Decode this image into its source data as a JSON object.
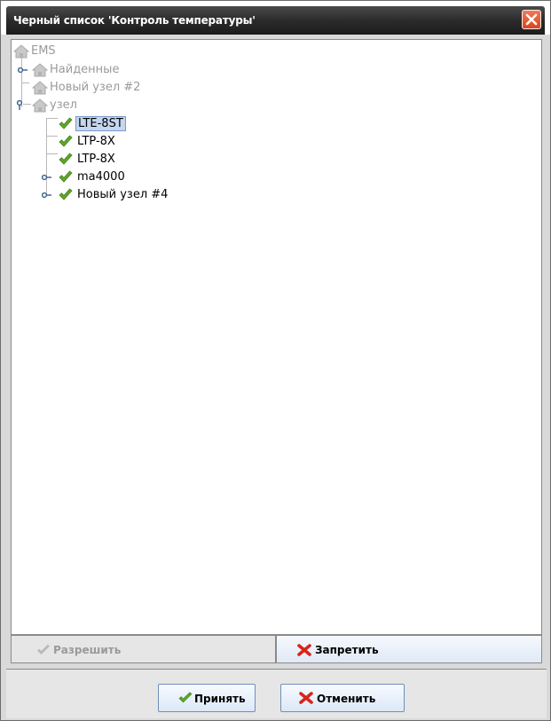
{
  "window": {
    "title": "Черный список 'Контроль температуры'"
  },
  "tree": {
    "nodes": [
      {
        "label": "EMS",
        "enabled": false
      },
      {
        "label": "Найденные",
        "enabled": false
      },
      {
        "label": "Новый узел #2",
        "enabled": false
      },
      {
        "label": "узел",
        "enabled": false
      },
      {
        "label": "LTE-8ST",
        "enabled": true,
        "selected": true
      },
      {
        "label": "LTP-8X",
        "enabled": true
      },
      {
        "label": "LTP-8X",
        "enabled": true
      },
      {
        "label": "ma4000",
        "enabled": true
      },
      {
        "label": "Новый узел #4",
        "enabled": true
      }
    ]
  },
  "actions": {
    "allow_label": "Разрешить",
    "deny_label": "Запретить"
  },
  "dialog": {
    "accept_label": "Принять",
    "cancel_label": "Отменить"
  },
  "icons": {
    "close": "close-icon",
    "house": "house-icon",
    "check": "checkmark-icon",
    "cross": "cross-icon"
  },
  "colors": {
    "titlebar": "#2b2b2b",
    "close": "#e0522b",
    "check": "#5fa82a",
    "cross": "#d8241c",
    "selection": "#c5d6ee"
  }
}
